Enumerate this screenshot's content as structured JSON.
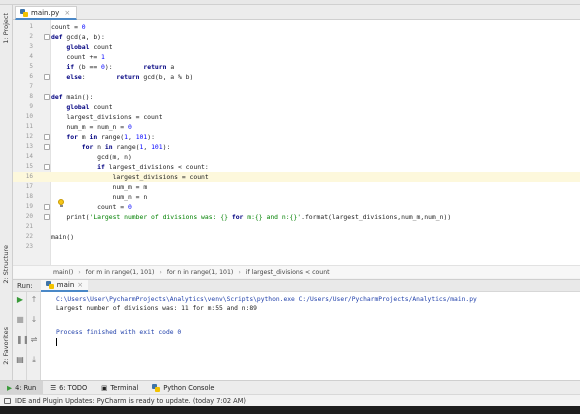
{
  "left_stripe": {
    "project_label": "1: Project",
    "structure_label": "2: Structure",
    "favorites_label": "2: Favorites"
  },
  "tabs": [
    {
      "label": "main.py",
      "close": "×"
    }
  ],
  "editor": {
    "lines": [
      {
        "n": "1",
        "code": "count = 0"
      },
      {
        "n": "2",
        "code": "def gcd(a, b):"
      },
      {
        "n": "3",
        "code": "    global count"
      },
      {
        "n": "4",
        "code": "    count += 1"
      },
      {
        "n": "5",
        "code": "    if (b == 0):        return a"
      },
      {
        "n": "6",
        "code": "    else:        return gcd(b, a % b)"
      },
      {
        "n": "7",
        "code": ""
      },
      {
        "n": "8",
        "code": "def main():"
      },
      {
        "n": "9",
        "code": "    global count"
      },
      {
        "n": "10",
        "code": "    largest_divisions = count"
      },
      {
        "n": "11",
        "code": "    num_m = num_n = 0"
      },
      {
        "n": "12",
        "code": "    for m in range(1, 101):"
      },
      {
        "n": "13",
        "code": "        for n in range(1, 101):"
      },
      {
        "n": "14",
        "code": "            gcd(m, n)"
      },
      {
        "n": "15",
        "code": "            if largest_divisions < count:"
      },
      {
        "n": "16",
        "code": "                largest_divisions = count"
      },
      {
        "n": "17",
        "code": "                num_m = m"
      },
      {
        "n": "18",
        "code": "                num_n = n"
      },
      {
        "n": "19",
        "code": "            count = 0"
      },
      {
        "n": "20",
        "code": "    print('Largest number of divisions was: {} for m:{} and n:{}'.format(largest_divisions,num_m,num_n))"
      },
      {
        "n": "21",
        "code": ""
      },
      {
        "n": "22",
        "code": "main()"
      },
      {
        "n": "23",
        "code": ""
      }
    ],
    "current_line": "16"
  },
  "breadcrumb": [
    "main()",
    "for m in range(1, 101)",
    "for n in range(1, 101)",
    "if largest_divisions < count"
  ],
  "run": {
    "title": "Run:",
    "tab_label": "main",
    "tab_close": "×",
    "console": [
      "C:\\Users\\User\\PycharmProjects\\Analytics\\venv\\Scripts\\python.exe C:/Users/User/PycharmProjects/Analytics/main.py",
      "Largest number of divisions was: 11 for m:55 and n:89",
      "",
      "Process finished with exit code 0"
    ]
  },
  "tool_windows": [
    {
      "label": "4: Run",
      "icon": "play-icon"
    },
    {
      "label": "6: TODO",
      "icon": "list-icon"
    },
    {
      "label": "Terminal",
      "icon": "terminal-icon"
    },
    {
      "label": "Python Console",
      "icon": "python-icon"
    }
  ],
  "status_bar": {
    "message": "IDE and Plugin Updates: PyCharm is ready to update. (today 7:02 AM)"
  },
  "colors": {
    "keyword": "#000080",
    "number": "#0000ff",
    "string": "#008000",
    "current_line": "#fdf8dc",
    "accent": "#4a88c7"
  }
}
